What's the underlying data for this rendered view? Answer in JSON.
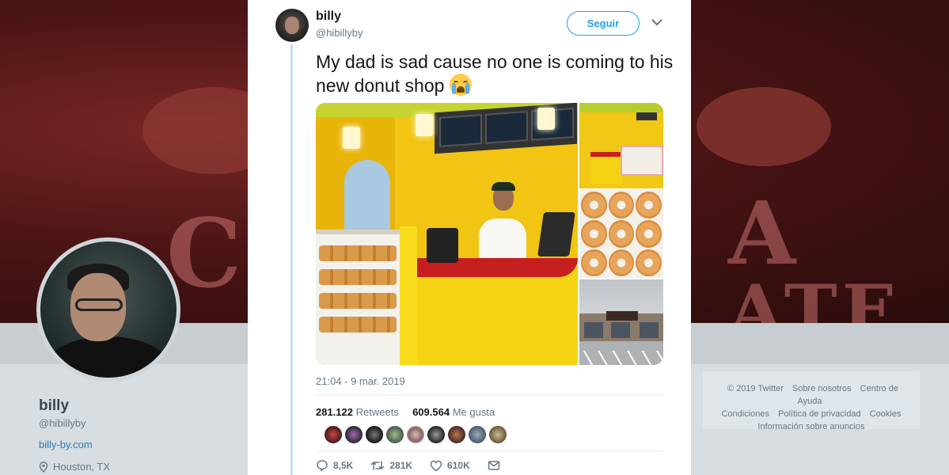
{
  "profile": {
    "name": "billy",
    "handle": "@hibillyby",
    "website": "billy-by.com",
    "location": "Houston, TX"
  },
  "footer": {
    "links": [
      "© 2019 Twitter",
      "Sobre nosotros",
      "Centro de Ayuda",
      "Condiciones",
      "Política de privacidad",
      "Cookies",
      "Información sobre anuncios"
    ]
  },
  "tweet": {
    "author_name": "billy",
    "author_handle": "@hibillyby",
    "follow_label": "Seguir",
    "text": "My dad is sad cause no one is coming to his new donut shop",
    "emoji": "loudly-crying-face",
    "timestamp": "21:04 - 9 mar. 2019",
    "retweets_count": "281.122",
    "retweets_label": "Retweets",
    "likes_count": "609.564",
    "likes_label": "Me gusta",
    "actions": {
      "reply": "8,5K",
      "retweet": "281K",
      "like": "610K"
    }
  },
  "colors": {
    "accent": "#1da1f2",
    "thread_line": "#c4dff3",
    "text": "#14171a",
    "muted": "#657786"
  },
  "icons": {
    "reply": "reply-icon",
    "retweet": "retweet-icon",
    "like": "heart-icon",
    "dm": "envelope-icon",
    "more": "chevron-down-icon",
    "location": "location-pin-icon"
  }
}
